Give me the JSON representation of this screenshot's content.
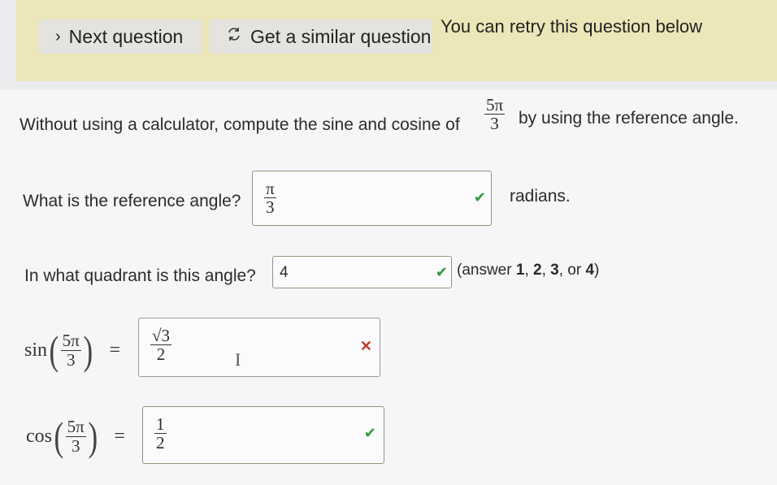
{
  "header": {
    "next_label": "Next question",
    "similar_label": "Get a similar question",
    "retry_text": "You can retry this question below"
  },
  "question": {
    "prefix": "Without using a calculator, compute the sine and cosine of",
    "angle_num": "5π",
    "angle_den": "3",
    "suffix": "by using the reference angle."
  },
  "reference": {
    "label": "What is the reference angle?",
    "answer_num": "π",
    "answer_den": "3",
    "unit": "radians."
  },
  "quadrant": {
    "label": "In what quadrant is this angle?",
    "answer": "4",
    "hint_prefix": "(answer ",
    "hint_1": "1",
    "hint_sep1": ", ",
    "hint_2": "2",
    "hint_sep2": ", ",
    "hint_3": "3",
    "hint_or": ", or ",
    "hint_4": "4",
    "hint_suffix": ")"
  },
  "sine": {
    "fn": "sin",
    "arg_num": "5π",
    "arg_den": "3",
    "equals": "=",
    "answer_num": "√3",
    "answer_den": "2"
  },
  "cosine": {
    "fn": "cos",
    "arg_num": "5π",
    "arg_den": "3",
    "equals": "=",
    "answer_num": "1",
    "answer_den": "2"
  },
  "icons": {
    "next": "chevron-right-icon",
    "similar": "refresh-icon",
    "correct": "check-icon",
    "incorrect": "x-icon",
    "cursor": "text-cursor-icon"
  },
  "colors": {
    "banner": "#ece6b8",
    "correct": "#2e9b3c",
    "incorrect": "#c0392b"
  }
}
